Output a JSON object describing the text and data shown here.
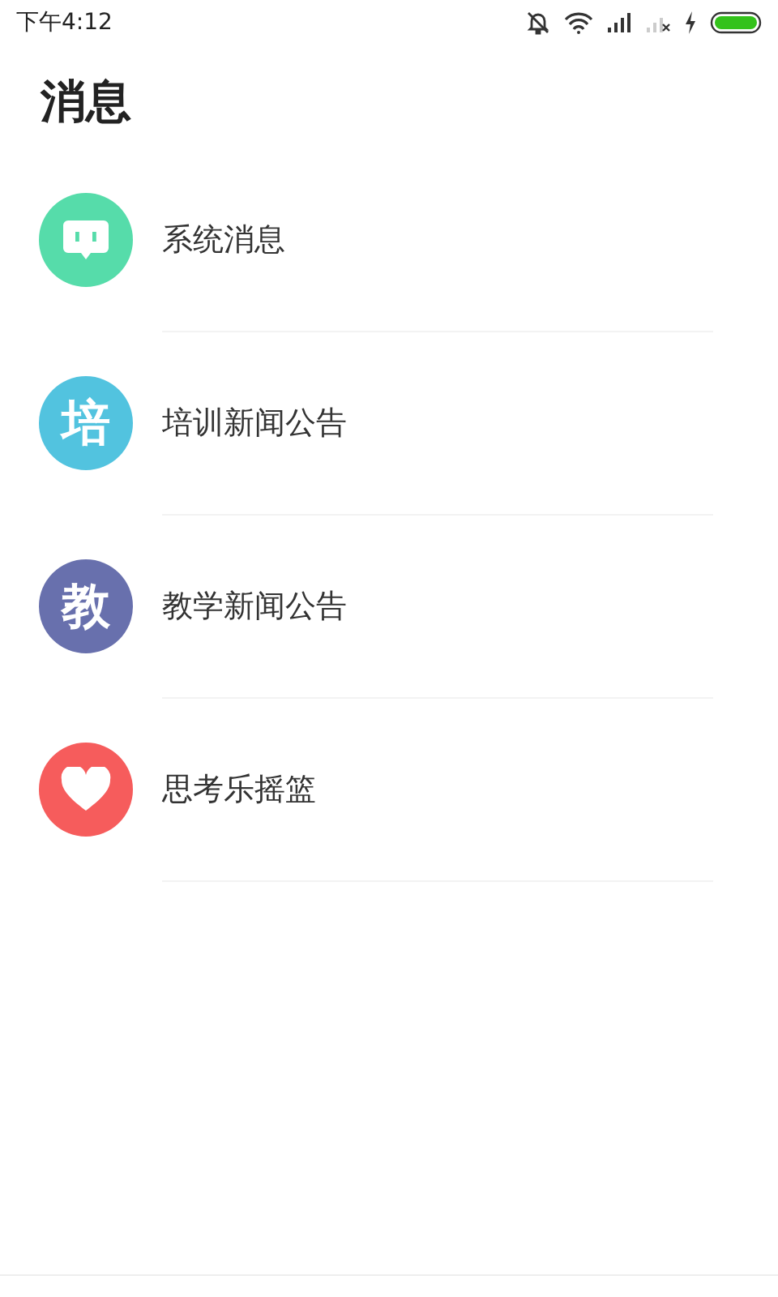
{
  "status_bar": {
    "time": "下午4:12"
  },
  "title": "消息",
  "items": [
    {
      "label": "系统消息",
      "color": "#56dcaa",
      "kind": "chat"
    },
    {
      "label": "培训新闻公告",
      "color": "#52c3df",
      "kind": "glyph",
      "glyph": "培"
    },
    {
      "label": "教学新闻公告",
      "color": "#6870ad",
      "kind": "glyph",
      "glyph": "教"
    },
    {
      "label": "思考乐摇篮",
      "color": "#f65c5c",
      "kind": "heart"
    }
  ]
}
